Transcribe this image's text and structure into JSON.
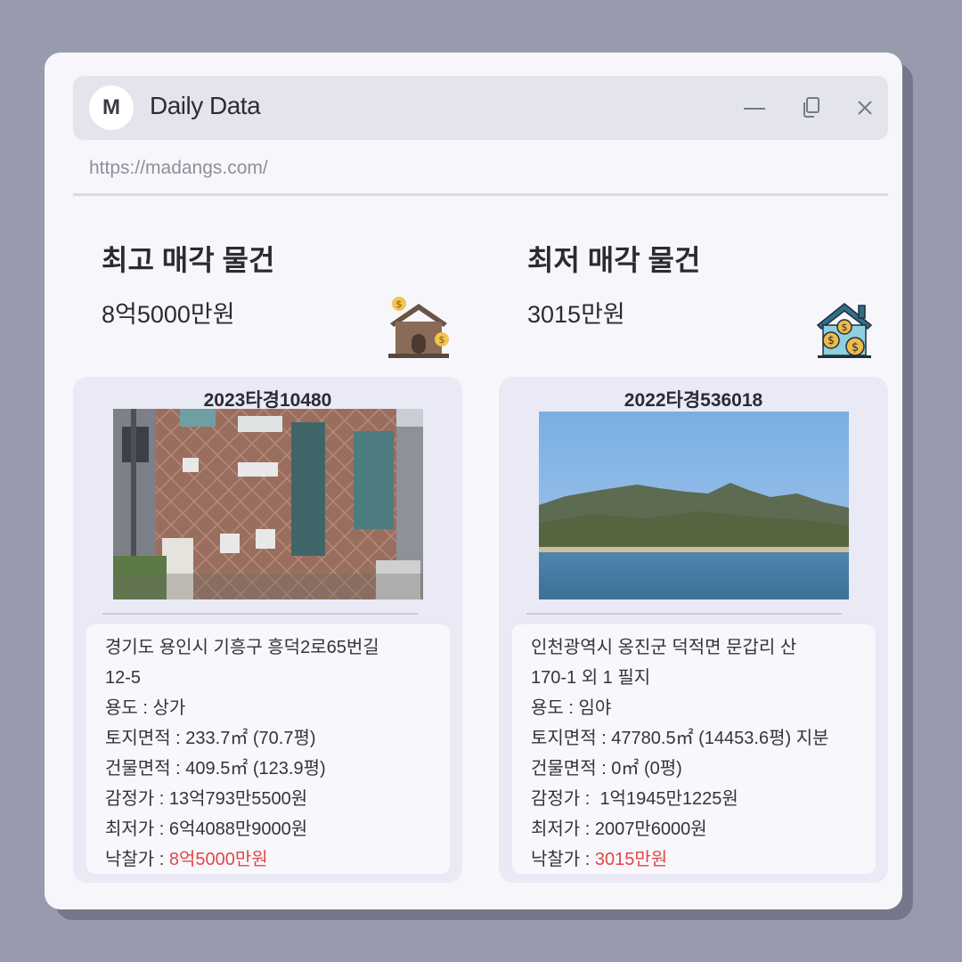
{
  "window": {
    "avatar_letter": "M",
    "title": "Daily Data",
    "url": "https://madangs.com/"
  },
  "highest": {
    "title": "최고 매각 물건",
    "price": "8억5000만원",
    "icon": "house-money-icon",
    "card": {
      "case_no": "2023타경10480",
      "photo": "brick-building-photo",
      "address_line1": "경기도 용인시 기흥구 흥덕2로65번길",
      "address_line2": "12-5",
      "usage_label": "용도 : ",
      "usage": "상가",
      "land_area_label": "토지면적 : ",
      "land_area": "233.7㎡ (70.7평)",
      "building_area_label": "건물면적 : ",
      "building_area": "409.5㎡ (123.9평)",
      "appraisal_label": "감정가 : ",
      "appraisal": "13억793만5500원",
      "minimum_label": "최저가 : ",
      "minimum": "6억4088만9000원",
      "winning_label": "낙찰가 : ",
      "winning": "8억5000만원"
    }
  },
  "lowest": {
    "title": "최저 매각 물건",
    "price": "3015만원",
    "icon": "house-coins-icon",
    "card": {
      "case_no": "2022타경536018",
      "photo": "mountain-sea-photo",
      "address_line1": "인천광역시 옹진군 덕적면 문갑리 산",
      "address_line2": "170-1 외 1 필지",
      "usage_label": "용도 : ",
      "usage": "임야",
      "land_area_label": "토지면적 : ",
      "land_area": "47780.5㎡ (14453.6평) 지분",
      "building_area_label": "건물면적 : ",
      "building_area": "0㎡ (0평)",
      "appraisal_label": "감정가 :  ",
      "appraisal": "1억1945만1225원",
      "minimum_label": "최저가 : ",
      "minimum": "2007만6000원",
      "winning_label": "낙찰가 : ",
      "winning": "3015만원"
    }
  },
  "colors": {
    "background": "#989aae",
    "window": "#f7f7fb",
    "titlebar": "#e4e5ec",
    "card": "#e9eaf5",
    "highlight_red": "#e24646"
  }
}
